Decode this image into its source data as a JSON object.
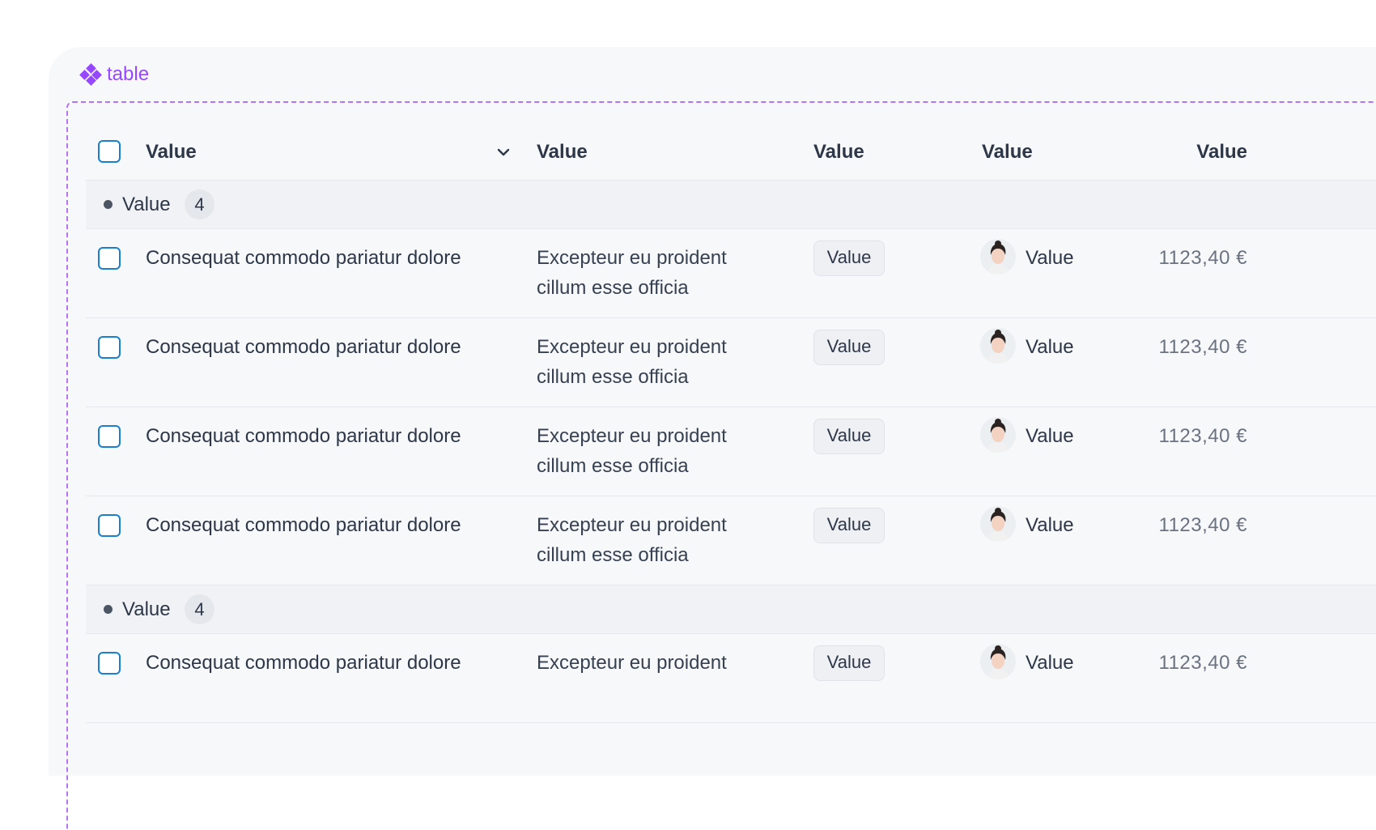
{
  "component": {
    "label": "table",
    "icon": "component-diamond-icon"
  },
  "colors": {
    "component_accent": "#9747ff",
    "checkbox_border": "#1a7fcf"
  },
  "table": {
    "headers": [
      "Value",
      "Value",
      "Value",
      "Value",
      "Value"
    ],
    "groups": [
      {
        "label": "Value",
        "count": "4",
        "rows": [
          {
            "name": "Consequat commodo pariatur dolore",
            "desc_line1": "Excepteur eu proident",
            "desc_line2": "cillum esse officia",
            "tag": "Value",
            "person": "Value",
            "amount": "1123,40 €"
          },
          {
            "name": "Consequat commodo pariatur dolore",
            "desc_line1": "Excepteur eu proident",
            "desc_line2": "cillum esse officia",
            "tag": "Value",
            "person": "Value",
            "amount": "1123,40 €"
          },
          {
            "name": "Consequat commodo pariatur dolore",
            "desc_line1": "Excepteur eu proident",
            "desc_line2": "cillum esse officia",
            "tag": "Value",
            "person": "Value",
            "amount": "1123,40 €"
          },
          {
            "name": "Consequat commodo pariatur dolore",
            "desc_line1": "Excepteur eu proident",
            "desc_line2": "cillum esse officia",
            "tag": "Value",
            "person": "Value",
            "amount": "1123,40 €"
          }
        ]
      },
      {
        "label": "Value",
        "count": "4",
        "rows": [
          {
            "name": "Consequat commodo pariatur dolore",
            "desc_line1": "Excepteur eu proident",
            "tag": "Value",
            "person": "Value",
            "amount": "1123,40 €"
          }
        ]
      }
    ]
  }
}
